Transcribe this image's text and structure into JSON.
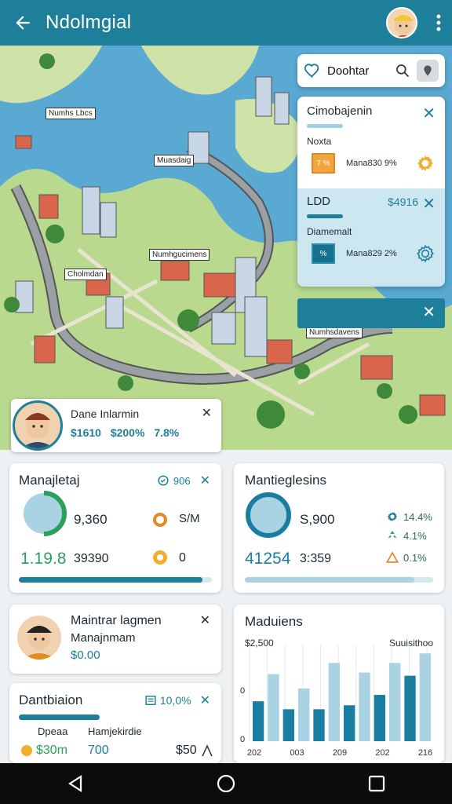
{
  "appbar": {
    "title": "Ndolmgial"
  },
  "map": {
    "labels": [
      "Numhs Lbcs",
      "Muasdaig",
      "Numhgucimens",
      "Cholmdan",
      "Numhsdavens"
    ]
  },
  "search": {
    "text": "Doohtar"
  },
  "panel": {
    "title": "Cimobajenin",
    "sub1": "Noxta",
    "row1_chip": "7 %",
    "row1_text": "Mana830 9%",
    "title2": "LDD",
    "value2": "$4916",
    "sub2": "Diamemalt",
    "row2_chip": "%",
    "row2_text": "Mana829 2%"
  },
  "mapcard": {
    "name": "Dane Inlarmin",
    "stat1": "$1610",
    "stat2": "$200%",
    "stat3": "7.8%"
  },
  "card1": {
    "title": "Manajletaj",
    "badge": "906",
    "val1": "9,360",
    "val2": "S/M",
    "big": "1.19.8",
    "val3": "39390",
    "val4": "0",
    "progress": 0.95
  },
  "card2": {
    "title": "Mantieglesins",
    "val1": "S,900",
    "p1": "14.4%",
    "p2": "4.1%",
    "big": "41254",
    "val2": "3:359",
    "p3": "0.1%",
    "progress": 0.9
  },
  "card3": {
    "name": "Maintrar lagmen",
    "role": "Manajnmam",
    "amount": "$0.00"
  },
  "card4": {
    "title": "Dantbiaion",
    "badge": "10,0%",
    "col1": "Dpeaa",
    "col2": "Hamjekirdie",
    "val1": "$30m",
    "val2": "700",
    "val3": "$50",
    "progress": 0.42
  },
  "card5": {
    "title": "Maduiens",
    "ylabel_top": "$2,500",
    "legend": "Suuisithoo",
    "yzero1": "0",
    "yzero2": "0"
  },
  "chart_data": {
    "type": "bar",
    "categories": [
      "1",
      "2",
      "3",
      "4",
      "5",
      "6",
      "7",
      "8",
      "9",
      "10",
      "11",
      "12"
    ],
    "xticks": [
      "202",
      "003",
      "209",
      "202",
      "216"
    ],
    "series": [
      {
        "values": [
          500,
          0,
          400,
          0,
          400,
          0,
          450,
          0,
          580,
          0,
          820,
          0
        ]
      },
      {
        "values": [
          0,
          840,
          0,
          660,
          0,
          980,
          0,
          860,
          0,
          980,
          0,
          1100
        ]
      }
    ],
    "colors": {
      "dark": "#1a7ea3",
      "light": "#a9d3e3"
    },
    "ylim": [
      0,
      1200
    ]
  },
  "colors": {
    "accent": "#1e7f9b",
    "green": "#2aa05a",
    "orange": "#e58a24"
  }
}
